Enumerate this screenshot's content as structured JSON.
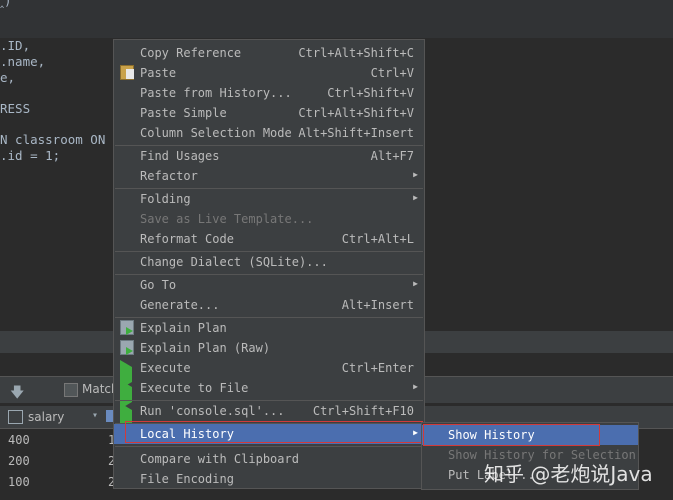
{
  "editor": {
    "top_fragment": "‸)",
    "lines": [
      {
        "text": ".ID,"
      },
      {
        "text": ".name,"
      },
      {
        "text": "e,"
      },
      {
        "text": "RESS"
      },
      {
        "text": "N classroom ON"
      },
      {
        "text": ".id = 1;"
      }
    ]
  },
  "toolbar": {
    "match_label": "Match"
  },
  "grid": {
    "column_header": "salary",
    "rows": [
      {
        "c1": "400",
        "c2": "1"
      },
      {
        "c1": "200",
        "c2": "2"
      },
      {
        "c1": "100",
        "c2": "2"
      }
    ]
  },
  "menu": {
    "items": [
      {
        "label": "Copy Reference",
        "shortcut": "Ctrl+Alt+Shift+C"
      },
      {
        "label": "Paste",
        "shortcut": "Ctrl+V",
        "icon": "paste-icon"
      },
      {
        "label": "Paste from History...",
        "shortcut": "Ctrl+Shift+V"
      },
      {
        "label": "Paste Simple",
        "shortcut": "Ctrl+Alt+Shift+V"
      },
      {
        "label": "Column Selection Mode",
        "shortcut": "Alt+Shift+Insert"
      },
      {
        "label": "Find Usages",
        "shortcut": "Alt+F7"
      },
      {
        "label": "Refactor",
        "shortcut": ""
      },
      {
        "label": "Folding",
        "shortcut": ""
      },
      {
        "label": "Save as Live Template...",
        "shortcut": ""
      },
      {
        "label": "Reformat Code",
        "shortcut": "Ctrl+Alt+L"
      },
      {
        "label": "Change Dialect (SQLite)...",
        "shortcut": ""
      },
      {
        "label": "Go To",
        "shortcut": ""
      },
      {
        "label": "Generate...",
        "shortcut": "Alt+Insert"
      },
      {
        "label": "Explain Plan",
        "shortcut": ""
      },
      {
        "label": "Explain Plan (Raw)",
        "shortcut": ""
      },
      {
        "label": "Execute",
        "shortcut": "Ctrl+Enter"
      },
      {
        "label": "Execute to File",
        "shortcut": ""
      },
      {
        "label": "Run 'console.sql'...",
        "shortcut": "Ctrl+Shift+F10"
      },
      {
        "label": "Local History",
        "shortcut": ""
      },
      {
        "label": "Compare with Clipboard",
        "shortcut": ""
      },
      {
        "label": "File Encoding",
        "shortcut": ""
      }
    ]
  },
  "submenu": {
    "items": [
      {
        "label": "Show History"
      },
      {
        "label": "Show History for Selection"
      },
      {
        "label": "Put Label..."
      }
    ]
  },
  "watermark": "知乎 @老炮说Java",
  "colors": {
    "menu_bg": "#3c3f41",
    "selection": "#4b6eaf",
    "highlight_border": "#d23a3a",
    "run_green": "#3fae3f"
  }
}
